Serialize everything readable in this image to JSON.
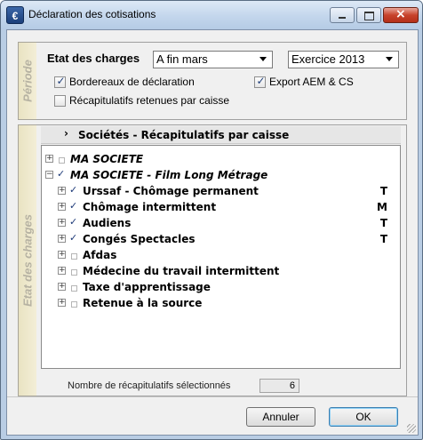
{
  "window": {
    "title": "Déclaration des cotisations",
    "icon_glyph": "€",
    "controls": {
      "minimize": "minimize-icon",
      "maximize": "maximize-icon",
      "close": "close-icon"
    }
  },
  "periode": {
    "section_label": "Période",
    "etat_label": "Etat des charges",
    "period_select": {
      "value": "A fin mars"
    },
    "exercise_select": {
      "value": "Exercice 2013"
    },
    "checkboxes": [
      {
        "label": "Bordereaux de déclaration",
        "checked": true
      },
      {
        "label": "Export AEM & CS",
        "checked": true
      },
      {
        "label": "Récapitulatifs retenues par caisse",
        "checked": false
      }
    ]
  },
  "etat": {
    "section_label": "Etat des charges",
    "header": "Sociétés - Récapitulatifs par caisse",
    "rows": [
      {
        "label": "MA SOCIETE",
        "italic": true,
        "expander": "+",
        "checked": false,
        "code": ""
      },
      {
        "label": "MA SOCIETE - Film Long Métrage",
        "italic": true,
        "expander": "−",
        "checked": true,
        "code": ""
      },
      {
        "label": "Urssaf - Chômage permanent",
        "italic": false,
        "expander": "+",
        "checked": true,
        "code": "T"
      },
      {
        "label": "Chômage intermittent",
        "italic": false,
        "expander": "+",
        "checked": true,
        "code": "M"
      },
      {
        "label": "Audiens",
        "italic": false,
        "expander": "+",
        "checked": true,
        "code": "T"
      },
      {
        "label": "Congés Spectacles",
        "italic": false,
        "expander": "+",
        "checked": true,
        "code": "T"
      },
      {
        "label": "Afdas",
        "italic": false,
        "expander": "+",
        "checked": false,
        "code": ""
      },
      {
        "label": "Médecine du travail intermittent",
        "italic": false,
        "expander": "+",
        "checked": false,
        "code": ""
      },
      {
        "label": "Taxe d'apprentissage",
        "italic": false,
        "expander": "+",
        "checked": false,
        "code": ""
      },
      {
        "label": "Retenue à la source",
        "italic": false,
        "expander": "+",
        "checked": false,
        "code": ""
      }
    ],
    "status_label": "Nombre de récapitulatifs sélectionnés",
    "status_count": "6"
  },
  "buttons": {
    "cancel": "Annuler",
    "ok": "OK"
  }
}
